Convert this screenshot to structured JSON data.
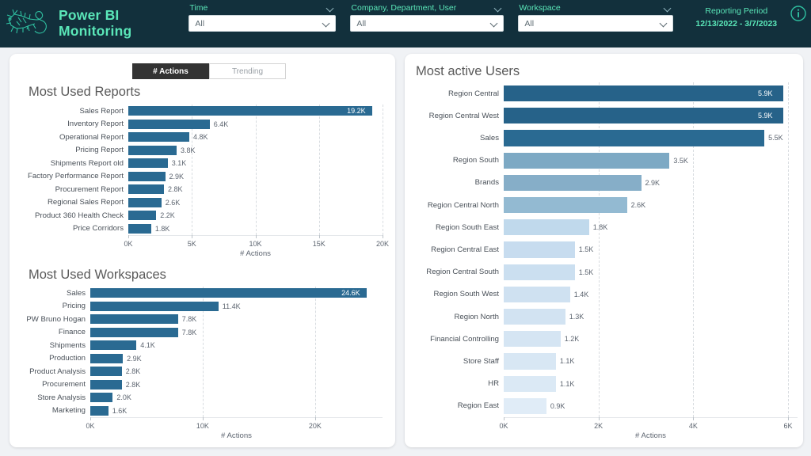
{
  "header": {
    "brand_line1": "Power BI",
    "brand_line2": "Monitoring",
    "logo_icon": "gecko-logo-icon",
    "info_icon": "info-circle-icon",
    "filters": [
      {
        "label": "Time",
        "value": "All",
        "placeholder": "All"
      },
      {
        "label": "Company, Department, User",
        "value": "All",
        "placeholder": "All"
      },
      {
        "label": "Workspace",
        "value": "All",
        "placeholder": "All"
      }
    ],
    "reporting_period_label": "Reporting Period",
    "reporting_period_value": "12/13/2022 - 3/7/2023",
    "accent_color": "#5ae6b8",
    "background_color": "#12303c"
  },
  "toggle": {
    "selected": "# Actions",
    "options": [
      "# Actions",
      "Trending"
    ]
  },
  "chart_data": [
    {
      "id": "most_used_reports",
      "type": "bar",
      "orientation": "horizontal",
      "title": "Most Used Reports",
      "xlabel": "# Actions",
      "ylabel": "",
      "xlim": [
        0,
        20000
      ],
      "xticks": [
        "0K",
        "5K",
        "10K",
        "15K",
        "20K"
      ],
      "xtick_values": [
        0,
        5000,
        10000,
        15000,
        20000
      ],
      "grid": true,
      "legend": "none",
      "bar_color": "#2a6a92",
      "categories": [
        "Sales Report",
        "Inventory Report",
        "Operational Report",
        "Pricing Report",
        "Shipments Report old",
        "Factory Performance Report",
        "Procurement Report",
        "Regional Sales Report",
        "Product 360 Health Check",
        "Price Corridors"
      ],
      "values": [
        19200,
        6400,
        4800,
        3800,
        3100,
        2900,
        2800,
        2600,
        2200,
        1800
      ],
      "labels": [
        "19.2K",
        "6.4K",
        "4.8K",
        "3.8K",
        "3.1K",
        "2.9K",
        "2.8K",
        "2.6K",
        "2.2K",
        "1.8K"
      ],
      "label_inside": [
        true,
        false,
        false,
        false,
        false,
        false,
        false,
        false,
        false,
        false
      ]
    },
    {
      "id": "most_used_workspaces",
      "type": "bar",
      "orientation": "horizontal",
      "title": "Most Used Workspaces",
      "xlabel": "# Actions",
      "ylabel": "",
      "xlim": [
        0,
        26000
      ],
      "xticks": [
        "0K",
        "10K",
        "20K"
      ],
      "xtick_values": [
        0,
        10000,
        20000
      ],
      "grid": true,
      "legend": "none",
      "bar_color": "#2a6a92",
      "categories": [
        "Sales",
        "Pricing",
        "PW Bruno Hogan",
        "Finance",
        "Shipments",
        "Production",
        "Product Analysis",
        "Procurement",
        "Store Analysis",
        "Marketing"
      ],
      "values": [
        24600,
        11400,
        7800,
        7800,
        4100,
        2900,
        2800,
        2800,
        2000,
        1600
      ],
      "labels": [
        "24.6K",
        "11.4K",
        "7.8K",
        "7.8K",
        "4.1K",
        "2.9K",
        "2.8K",
        "2.8K",
        "2.0K",
        "1.6K"
      ],
      "label_inside": [
        true,
        false,
        false,
        false,
        false,
        false,
        false,
        false,
        false,
        false
      ]
    },
    {
      "id": "most_active_users",
      "type": "bar",
      "orientation": "horizontal",
      "title": "Most active Users",
      "xlabel": "# Actions",
      "ylabel": "",
      "xlim": [
        0,
        6200
      ],
      "xticks": [
        "0K",
        "2K",
        "4K",
        "6K"
      ],
      "xtick_values": [
        0,
        2000,
        4000,
        6000
      ],
      "grid": true,
      "legend": "none",
      "categories": [
        "Region Central",
        "Region Central West",
        "Sales",
        "Region South",
        "Brands",
        "Region Central North",
        "Region South East",
        "Region Central East",
        "Region Central South",
        "Region South West",
        "Region North",
        "Financial Controlling",
        "Store Staff",
        "HR",
        "Region East"
      ],
      "values": [
        5900,
        5900,
        5500,
        3500,
        2900,
        2600,
        1800,
        1500,
        1500,
        1400,
        1300,
        1200,
        1100,
        1100,
        900
      ],
      "labels": [
        "5.9K",
        "5.9K",
        "5.5K",
        "3.5K",
        "2.9K",
        "2.6K",
        "1.8K",
        "1.5K",
        "1.5K",
        "1.4K",
        "1.3K",
        "1.2K",
        "1.1K",
        "1.1K",
        "0.9K"
      ],
      "label_inside": [
        true,
        true,
        false,
        false,
        false,
        false,
        false,
        false,
        false,
        false,
        false,
        false,
        false,
        false,
        false
      ],
      "bar_colors": [
        "#266289",
        "#266289",
        "#2a6a92",
        "#7da9c4",
        "#86aec8",
        "#93bad2",
        "#c0d9ec",
        "#c7dcef",
        "#cbdff0",
        "#cfe1f1",
        "#d2e3f2",
        "#d5e5f3",
        "#d8e7f4",
        "#dbe9f5",
        "#e0ecf7"
      ]
    }
  ]
}
